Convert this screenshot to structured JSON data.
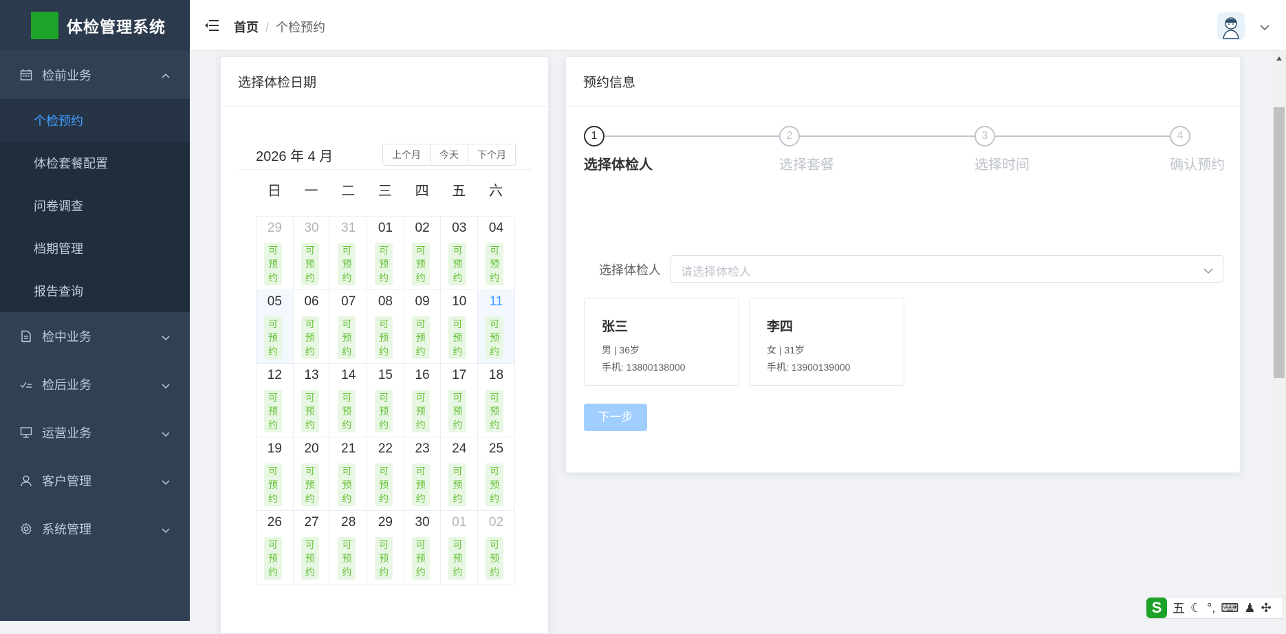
{
  "app": {
    "title": "体检管理系统"
  },
  "sidebar": {
    "groups": [
      {
        "label": "检前业务",
        "icon": "calendar-icon",
        "expanded": true,
        "items": [
          {
            "label": "个检预约",
            "active": true
          },
          {
            "label": "体检套餐配置"
          },
          {
            "label": "问卷调查"
          },
          {
            "label": "档期管理"
          },
          {
            "label": "报告查询"
          }
        ]
      },
      {
        "label": "检中业务",
        "icon": "document-icon"
      },
      {
        "label": "检后业务",
        "icon": "check-list-icon"
      },
      {
        "label": "运营业务",
        "icon": "presentation-icon"
      },
      {
        "label": "客户管理",
        "icon": "user-icon"
      },
      {
        "label": "系统管理",
        "icon": "gear-icon"
      }
    ]
  },
  "header": {
    "breadcrumb": {
      "home": "首页",
      "separator": "/",
      "current": "个检预约"
    }
  },
  "calendar_card": {
    "title": "选择体检日期",
    "month_title": "2026 年 4 月",
    "buttons": {
      "prev": "上个月",
      "today": "今天",
      "next": "下个月"
    },
    "weekdays": [
      "日",
      "一",
      "二",
      "三",
      "四",
      "五",
      "六"
    ],
    "badge_text": [
      "可",
      "预",
      "约"
    ],
    "days": [
      {
        "d": "29",
        "other": true
      },
      {
        "d": "30",
        "other": true
      },
      {
        "d": "31",
        "other": true
      },
      {
        "d": "01"
      },
      {
        "d": "02"
      },
      {
        "d": "03"
      },
      {
        "d": "04"
      },
      {
        "d": "05",
        "hl": true
      },
      {
        "d": "06"
      },
      {
        "d": "07"
      },
      {
        "d": "08"
      },
      {
        "d": "09"
      },
      {
        "d": "10"
      },
      {
        "d": "11",
        "today": true,
        "hl": true
      },
      {
        "d": "12"
      },
      {
        "d": "13"
      },
      {
        "d": "14"
      },
      {
        "d": "15"
      },
      {
        "d": "16"
      },
      {
        "d": "17"
      },
      {
        "d": "18"
      },
      {
        "d": "19"
      },
      {
        "d": "20"
      },
      {
        "d": "21"
      },
      {
        "d": "22"
      },
      {
        "d": "23"
      },
      {
        "d": "24"
      },
      {
        "d": "25"
      },
      {
        "d": "26"
      },
      {
        "d": "27"
      },
      {
        "d": "28"
      },
      {
        "d": "29"
      },
      {
        "d": "30"
      },
      {
        "d": "01",
        "other": true
      },
      {
        "d": "02",
        "other": true
      }
    ]
  },
  "info_card": {
    "title": "预约信息",
    "steps": [
      {
        "num": "1",
        "label": "选择体检人",
        "active": true
      },
      {
        "num": "2",
        "label": "选择套餐"
      },
      {
        "num": "3",
        "label": "选择时间"
      },
      {
        "num": "4",
        "label": "确认预约"
      }
    ],
    "select": {
      "label": "选择体检人",
      "placeholder": "请选择体检人"
    },
    "persons": [
      {
        "name": "张三",
        "meta": "男 | 36岁",
        "phone": "手机: 13800138000"
      },
      {
        "name": "李四",
        "meta": "女 | 31岁",
        "phone": "手机: 13900139000"
      }
    ],
    "next_button": "下一步"
  },
  "ime_toolbar": {
    "mode": "五",
    "punct": "°,"
  },
  "colors": {
    "sidebar_bg": "#304156",
    "active_text": "#409eff",
    "badge_bg": "#e8f7e3",
    "badge_text": "#67c23a",
    "logo_green": "#1ea329"
  }
}
